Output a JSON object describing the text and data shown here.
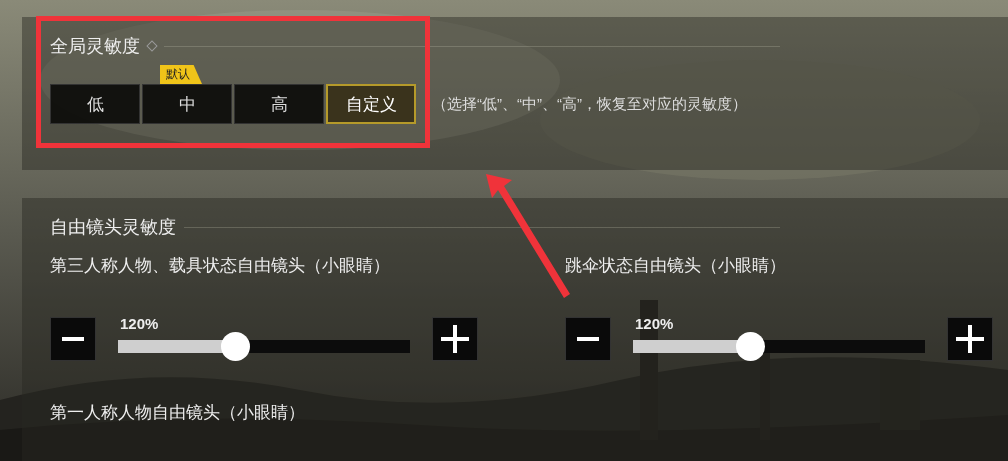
{
  "global_sensitivity": {
    "title": "全局灵敏度",
    "options": [
      {
        "label": "低",
        "selected": false
      },
      {
        "label": "中",
        "selected": false,
        "badge": "默认"
      },
      {
        "label": "高",
        "selected": false
      },
      {
        "label": "自定义",
        "selected": true
      }
    ],
    "hint": "（选择“低”、“中”、“高”，恢复至对应的灵敏度）"
  },
  "free_camera": {
    "title": "自由镜头灵敏度",
    "sliders": [
      {
        "label": "第三人称人物、载具状态自由镜头（小眼睛）",
        "value": "120%",
        "level": 0.4
      },
      {
        "label": "跳伞状态自由镜头（小眼睛）",
        "value": "120%",
        "level": 0.4
      }
    ],
    "next_label": "第一人称人物自由镜头（小眼睛）"
  },
  "annotation": {
    "highlight_frame": true,
    "arrow": true
  }
}
